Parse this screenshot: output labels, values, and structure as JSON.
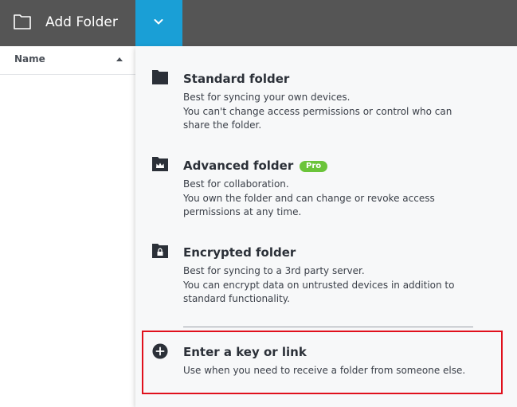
{
  "toolbar": {
    "add_folder_label": "Add Folder",
    "icons": {
      "folder": "folder-outline-icon",
      "dropdown": "chevron-down-icon"
    },
    "accent_color": "#1a9fd6"
  },
  "list": {
    "column_name": "Name",
    "sort": "ascending"
  },
  "menu": {
    "options": [
      {
        "title": "Standard folder",
        "lines": [
          "Best for syncing your own devices.",
          "You can't change access permissions or control who can",
          "share the folder."
        ],
        "icon": "folder-solid-icon"
      },
      {
        "title": "Advanced folder",
        "badge": "Pro",
        "lines": [
          "Best for collaboration.",
          "You own the folder and can change or revoke access",
          "permissions at any time."
        ],
        "icon": "folder-crown-icon"
      },
      {
        "title": "Encrypted folder",
        "lines": [
          "Best for syncing to a 3rd party server.",
          "You can encrypt data on untrusted devices in addition to",
          "standard functionality."
        ],
        "icon": "folder-lock-icon"
      },
      {
        "title": "Enter a key or link",
        "lines": [
          "Use when you need to receive a folder from someone else."
        ],
        "icon": "plus-circle-icon"
      }
    ]
  }
}
